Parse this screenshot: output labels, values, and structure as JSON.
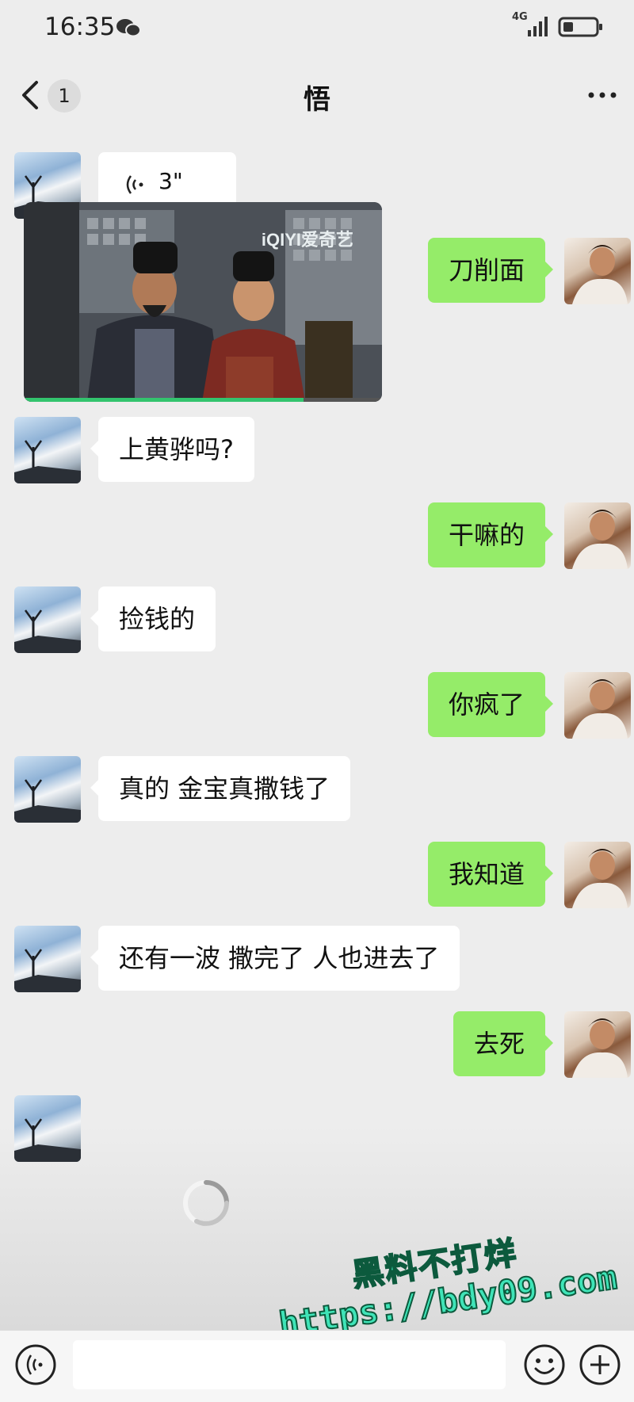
{
  "status_bar": {
    "time": "16:35",
    "network": "4G"
  },
  "header": {
    "back_badge": "1",
    "title": "悟"
  },
  "messages": [
    {
      "side": "peer",
      "type": "voice",
      "duration": "3\""
    },
    {
      "side": "peer",
      "type": "video",
      "watermark": "iQIYI爱奇艺"
    },
    {
      "side": "me",
      "type": "text",
      "text": "刀削面"
    },
    {
      "side": "peer",
      "type": "text",
      "text": "上黄骅吗?"
    },
    {
      "side": "me",
      "type": "text",
      "text": "干嘛的"
    },
    {
      "side": "peer",
      "type": "text",
      "text": "捡钱的"
    },
    {
      "side": "me",
      "type": "text",
      "text": "你疯了"
    },
    {
      "side": "peer",
      "type": "text",
      "text": "真的 金宝真撒钱了"
    },
    {
      "side": "me",
      "type": "text",
      "text": "我知道"
    },
    {
      "side": "peer",
      "type": "text",
      "text": "还有一波 撒完了 人也进去了"
    },
    {
      "side": "me",
      "type": "text",
      "text": "去死"
    },
    {
      "side": "peer",
      "type": "loading"
    }
  ],
  "watermark": {
    "line1": "黑料不打烊",
    "line2": "https://bdy09.com"
  },
  "colors": {
    "background": "#ededed",
    "my_bubble": "#95ec69",
    "peer_bubble": "#ffffff"
  },
  "icons": {
    "back": "chevron-left-icon",
    "more": "more-dots-icon",
    "voice": "voice-wave-icon",
    "emoji": "emoji-icon",
    "plus": "plus-icon"
  }
}
